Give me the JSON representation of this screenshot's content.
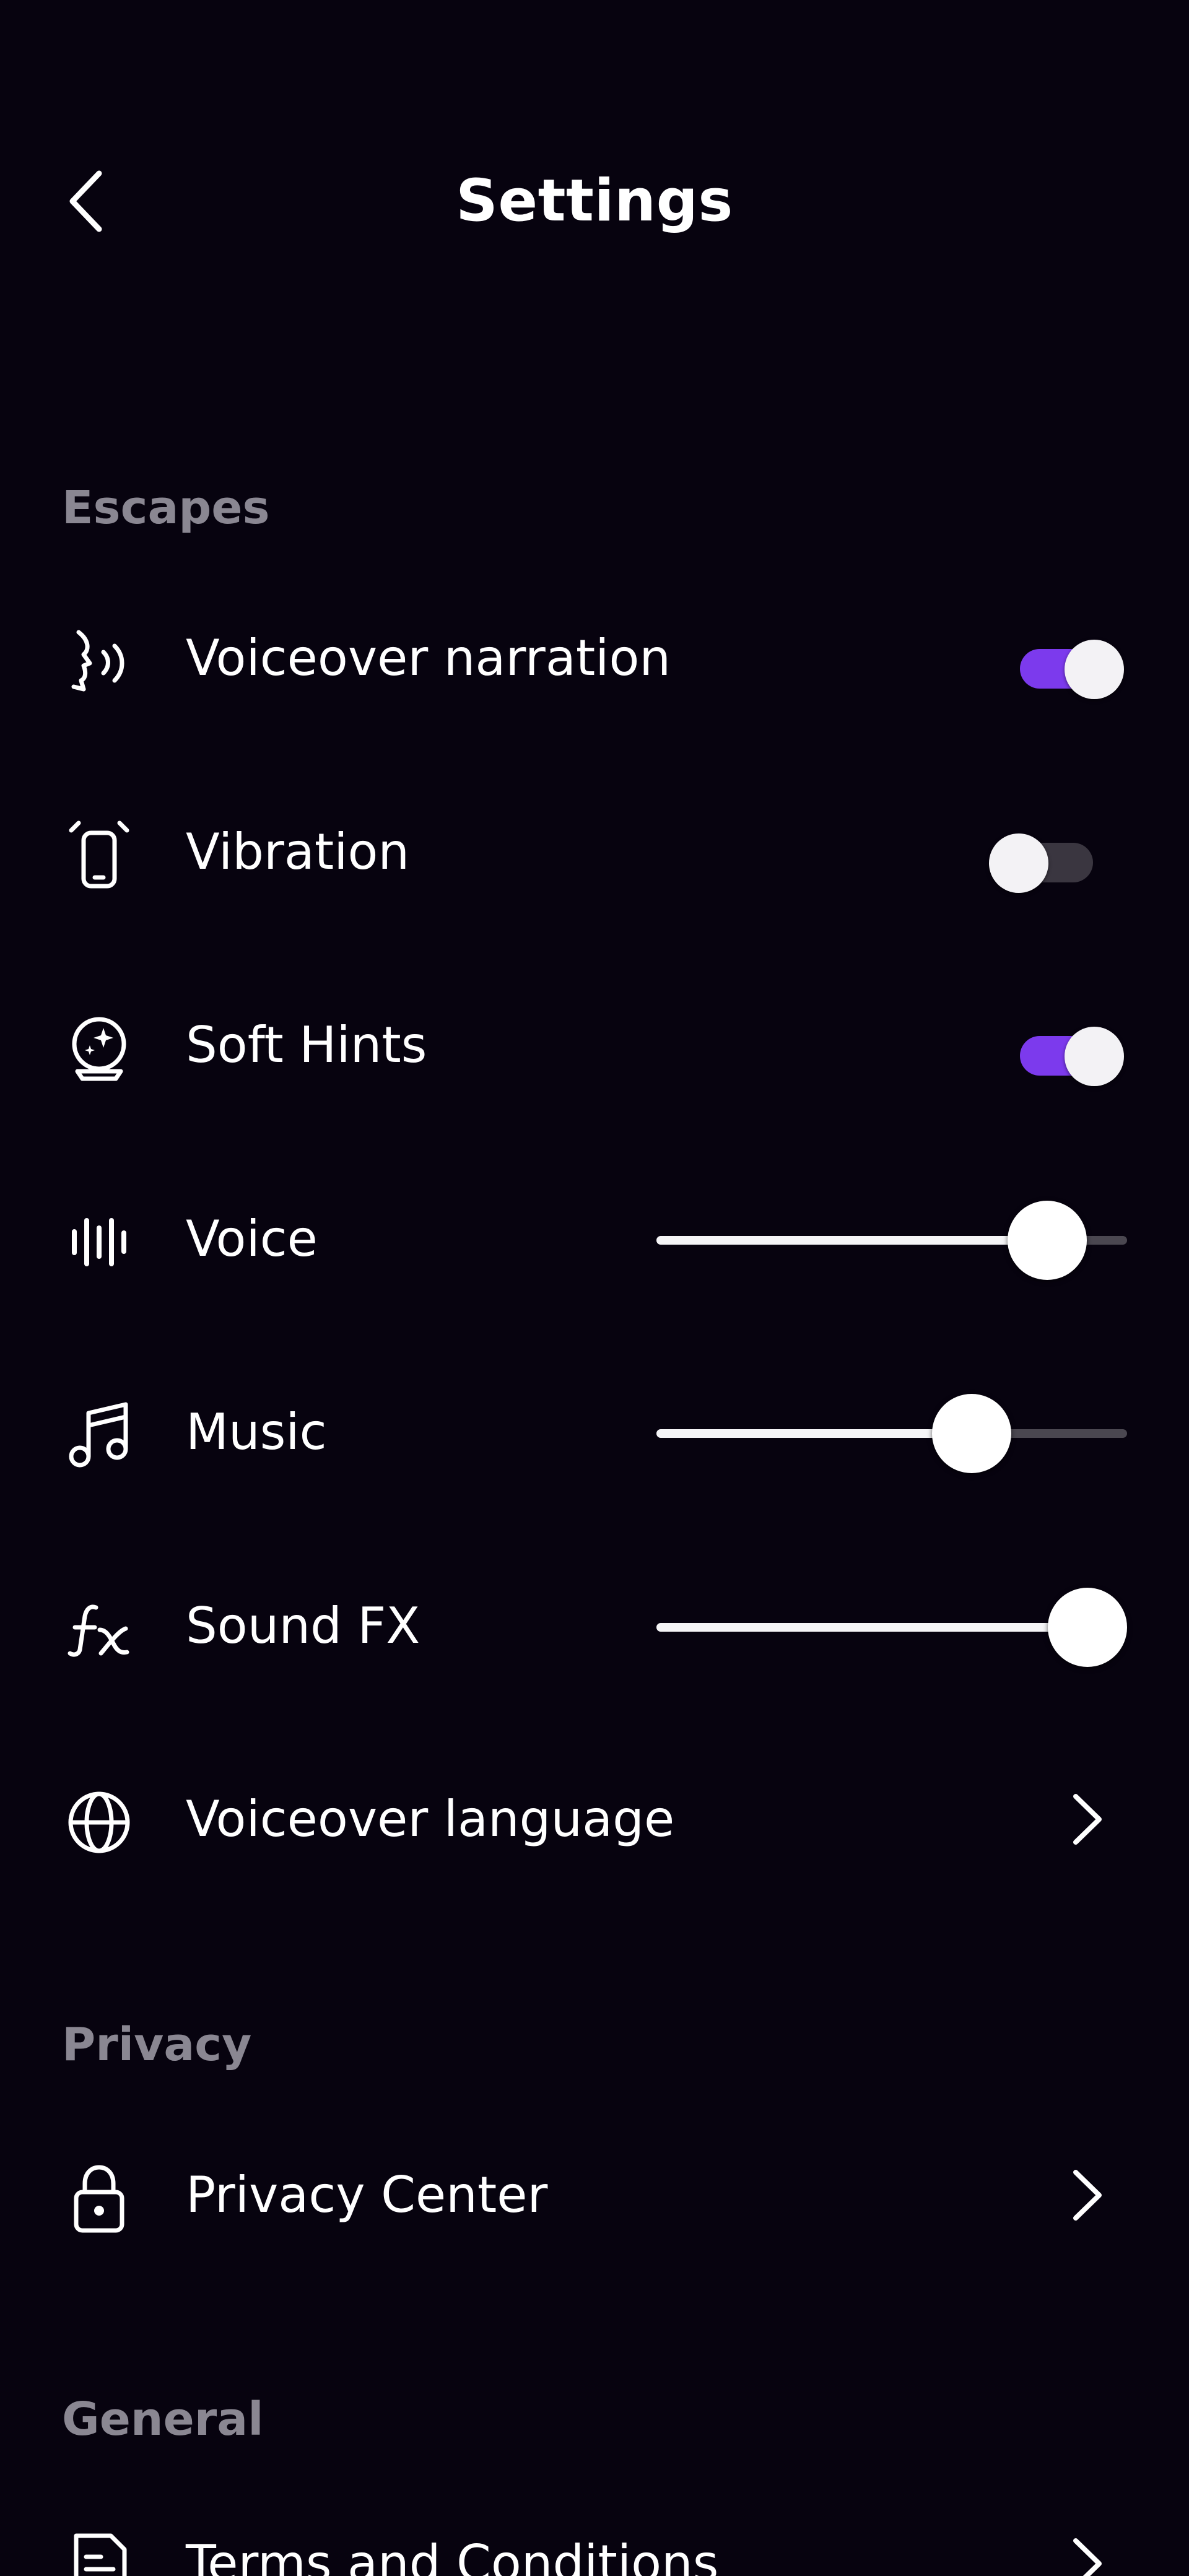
{
  "header": {
    "title": "Settings",
    "back_icon": "chevron-left-icon"
  },
  "sections": {
    "escapes": "Escapes",
    "privacy": "Privacy",
    "general": "General"
  },
  "rows": {
    "voiceover_narration": {
      "label": "Voiceover narration",
      "icon": "speaking-head-icon",
      "enabled": true
    },
    "vibration": {
      "label": "Vibration",
      "icon": "phone-vibrate-icon",
      "enabled": false
    },
    "soft_hints": {
      "label": "Soft Hints",
      "icon": "crystal-ball-icon",
      "enabled": true
    },
    "voice": {
      "label": "Voice",
      "icon": "waveform-icon",
      "level": 0.83
    },
    "music": {
      "label": "Music",
      "icon": "music-note-icon",
      "level": 0.67
    },
    "sound_fx": {
      "label": "Sound FX",
      "icon": "fx-icon",
      "level": 1.0
    },
    "voiceover_language": {
      "label": "Voiceover language",
      "icon": "globe-icon"
    },
    "privacy_center": {
      "label": "Privacy Center",
      "icon": "lock-icon"
    },
    "terms": {
      "label": "Terms and Conditions",
      "icon": "document-icon"
    }
  },
  "colors": {
    "background": "#07030f",
    "accent": "#7c3aed",
    "section_title": "#8a8792",
    "toggle_off_track": "#3a3640"
  }
}
